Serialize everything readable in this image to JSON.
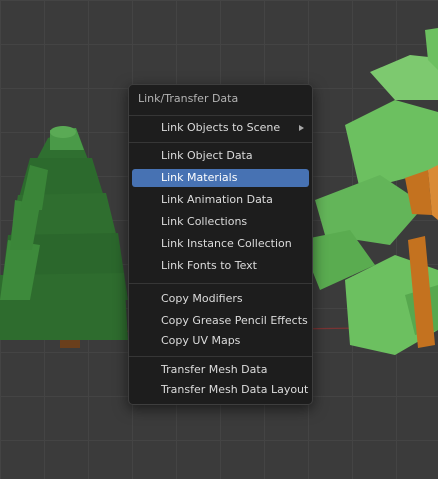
{
  "menu": {
    "title": "Link/Transfer Data",
    "items": [
      {
        "label": "Link Objects to Scene",
        "submenu": true
      },
      {
        "label": "Link Object Data"
      },
      {
        "label": "Link Materials",
        "active": true
      },
      {
        "label": "Link Animation Data"
      },
      {
        "label": "Link Collections"
      },
      {
        "label": "Link Instance Collection"
      },
      {
        "label": "Link Fonts to Text"
      },
      {
        "label": "Copy Modifiers"
      },
      {
        "label": "Copy Grease Pencil Effects"
      },
      {
        "label": "Copy UV Maps"
      },
      {
        "label": "Transfer Mesh Data"
      },
      {
        "label": "Transfer Mesh Data Layout"
      }
    ]
  },
  "colors": {
    "viewport_bg": "#3b3b3b",
    "menu_bg": "#1d1d1d",
    "highlight": "#4772b3",
    "tree_green": "#2f6f2f",
    "foliage_green": "#6cc060",
    "trunk_orange": "#c4721f"
  },
  "icons": [
    "submenu-arrow-icon"
  ]
}
